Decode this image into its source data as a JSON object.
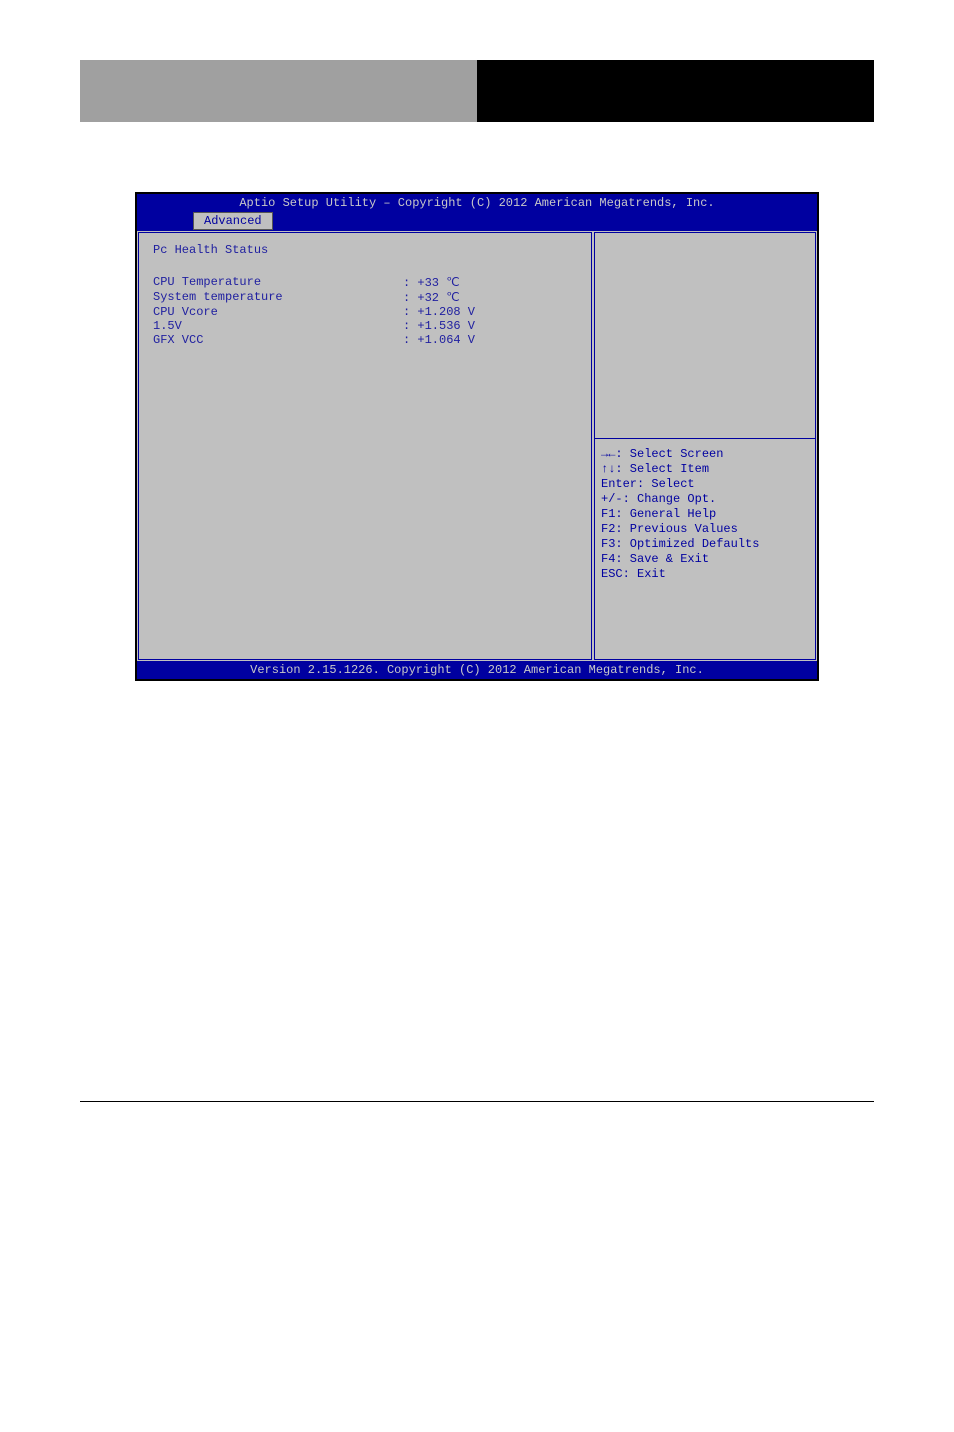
{
  "bios": {
    "title": "Aptio Setup Utility – Copyright (C) 2012 American Megatrends, Inc.",
    "tab": "Advanced",
    "section_title": "Pc Health Status",
    "items": [
      {
        "label": "CPU Temperature",
        "value": ": +33 ℃"
      },
      {
        "label": "System temperature",
        "value": ": +32 ℃"
      },
      {
        "label": "CPU Vcore",
        "value": ": +1.208 V"
      },
      {
        "label": "1.5V",
        "value": ": +1.536 V"
      },
      {
        "label": "GFX VCC",
        "value": ": +1.064 V"
      }
    ],
    "keys": [
      "→←: Select Screen",
      "↑↓: Select Item",
      "Enter: Select",
      "+/-: Change Opt.",
      "F1: General Help",
      "F2: Previous Values",
      "F3: Optimized Defaults",
      "F4: Save & Exit",
      "ESC: Exit"
    ],
    "footer": "Version 2.15.1226. Copyright (C) 2012 American Megatrends, Inc."
  }
}
